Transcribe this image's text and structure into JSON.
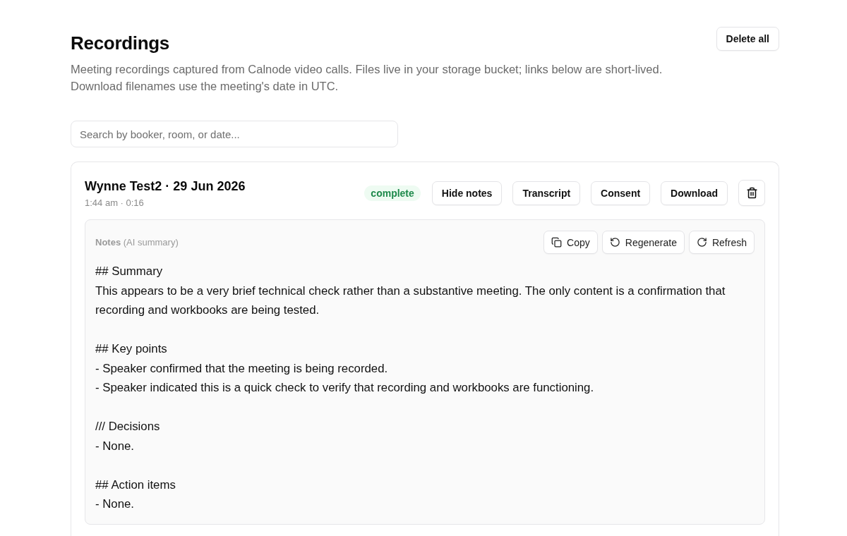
{
  "page": {
    "title": "Recordings",
    "description": "Meeting recordings captured from Calnode video calls. Files live in your storage bucket; links below are short-lived. Download filenames use the meeting's date in UTC.",
    "delete_all_button": "Delete all"
  },
  "search": {
    "placeholder": "Search by booker, room, or date..."
  },
  "recordings": [
    {
      "title": "Wynne Test2 · 29 Jun 2026",
      "meta": "1:44 am · 0:16",
      "status": {
        "label": "complete",
        "kind": "success"
      },
      "actions": [
        {
          "label": "Hide notes"
        },
        {
          "label": "Transcript"
        },
        {
          "label": "Consent"
        },
        {
          "label": "Download"
        }
      ],
      "notes": {
        "label": "**Notes** (AI summary)",
        "buttons": [
          {
            "label": "Copy",
            "kind": "copy"
          },
          {
            "label": "Regenerate",
            "kind": "regenerate"
          },
          {
            "label": "Refresh",
            "kind": "refresh"
          }
        ],
        "sections": [
          {
            "heading": "## Summary",
            "lines": [
              "This appears to be a very brief technical check rather than a substantive meeting. The only content is a confirmation that recording and workbooks are being tested."
            ]
          },
          {
            "heading": "## Key points",
            "lines": [
              "- Speaker confirmed that the meeting is being recorded.",
              "- Speaker indicated this is a quick check to verify that recording and workbooks are functioning."
            ]
          },
          {
            "heading": "/// Decisions",
            "lines": [
              "- None."
            ]
          },
          {
            "heading": "## Action items",
            "lines": [
              "- None."
            ]
          }
        ]
      }
    }
  ]
}
